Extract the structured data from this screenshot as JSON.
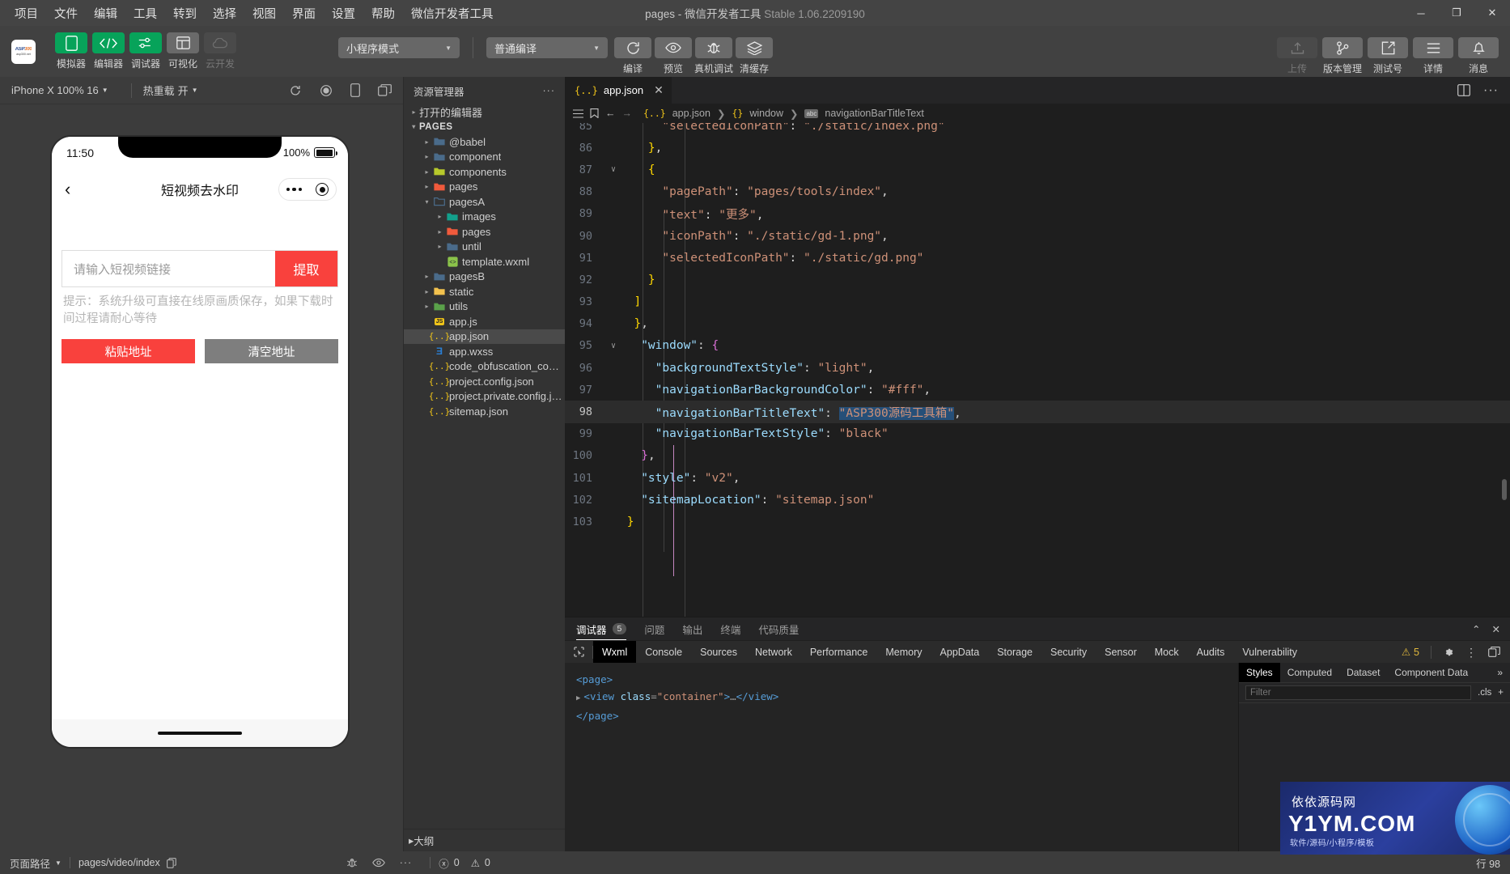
{
  "titlebar": {
    "menus": [
      "项目",
      "文件",
      "编辑",
      "工具",
      "转到",
      "选择",
      "视图",
      "界面",
      "设置",
      "帮助",
      "微信开发者工具"
    ],
    "title_main": "pages - 微信开发者工具 ",
    "title_version": "Stable 1.06.2209190",
    "minimize": "─",
    "maximize": "❐",
    "close": "✕"
  },
  "toolbar": {
    "logo_line1": "ASP300",
    "logo_line2": "asp300.net",
    "left_buttons": [
      {
        "label": "模拟器",
        "icon": "phone-icon",
        "style": "green"
      },
      {
        "label": "编辑器",
        "icon": "code-icon",
        "style": "green"
      },
      {
        "label": "调试器",
        "icon": "sliders-icon",
        "style": "green"
      },
      {
        "label": "可视化",
        "icon": "layout-icon",
        "style": "grey"
      },
      {
        "label": "云开发",
        "icon": "cloud-icon",
        "style": "off"
      }
    ],
    "mode_select": "小程序模式",
    "compile_select": "普通编译",
    "mid_buttons": [
      {
        "label": "编译",
        "icon": "refresh-icon"
      },
      {
        "label": "预览",
        "icon": "eye-icon"
      },
      {
        "label": "真机调试",
        "icon": "bug-icon"
      },
      {
        "label": "清缓存",
        "icon": "layers-icon"
      }
    ],
    "right_buttons": [
      {
        "label": "上传",
        "icon": "upload-icon",
        "disabled": true
      },
      {
        "label": "版本管理",
        "icon": "branch-icon",
        "disabled": false
      },
      {
        "label": "测试号",
        "icon": "external-link-icon",
        "disabled": false
      },
      {
        "label": "详情",
        "icon": "menu-icon",
        "disabled": false
      },
      {
        "label": "消息",
        "icon": "bell-icon",
        "disabled": false
      }
    ]
  },
  "simulator": {
    "device_select": "iPhone X 100% 16",
    "hotreload_label": "热重载",
    "hotreload_value": "开",
    "icons": [
      "refresh-icon",
      "record-icon",
      "rotate-icon",
      "popout-icon"
    ],
    "phone": {
      "status_time": "11:50",
      "battery_percent": "100%",
      "nav_title": "短视频去水印",
      "back_icon": "chevron-left-icon",
      "input_placeholder": "请输入短视频链接",
      "extract_button": "提取",
      "tip_text": "提示：系统升级可直接在线原画质保存，如果下载时间过程请耐心等待",
      "paste_button": "粘贴地址",
      "clear_button": "清空地址"
    }
  },
  "explorer": {
    "header": "资源管理器",
    "more_icon": "ellipsis-icon",
    "open_editors": "打开的编辑器",
    "project_root": "PAGES",
    "outline": "大纲",
    "tree": [
      {
        "name": "@babel",
        "indent": 1,
        "type": "folder",
        "arrow": "▸",
        "color": "#4a6b8a",
        "selected": false
      },
      {
        "name": "component",
        "indent": 1,
        "type": "folder",
        "arrow": "▸",
        "color": "#4a6b8a",
        "selected": false
      },
      {
        "name": "components",
        "indent": 1,
        "type": "folder",
        "arrow": "▸",
        "color": "#b7c92b",
        "selected": false
      },
      {
        "name": "pages",
        "indent": 1,
        "type": "folder",
        "arrow": "▸",
        "color": "#f05a3c",
        "selected": false
      },
      {
        "name": "pagesA",
        "indent": 1,
        "type": "folder-open",
        "arrow": "▾",
        "color": "#4a6b8a",
        "selected": false
      },
      {
        "name": "images",
        "indent": 2,
        "type": "folder",
        "arrow": "▸",
        "color": "#13a08c",
        "selected": false
      },
      {
        "name": "pages",
        "indent": 2,
        "type": "folder",
        "arrow": "▸",
        "color": "#f05a3c",
        "selected": false
      },
      {
        "name": "until",
        "indent": 2,
        "type": "folder",
        "arrow": "▸",
        "color": "#4a6b8a",
        "selected": false
      },
      {
        "name": "template.wxml",
        "indent": 2,
        "type": "wxml",
        "arrow": "",
        "color": "#8bc34a",
        "selected": false
      },
      {
        "name": "pagesB",
        "indent": 1,
        "type": "folder",
        "arrow": "▸",
        "color": "#4a6b8a",
        "selected": false
      },
      {
        "name": "static",
        "indent": 1,
        "type": "folder",
        "arrow": "▸",
        "color": "#f2c14e",
        "selected": false
      },
      {
        "name": "utils",
        "indent": 1,
        "type": "folder",
        "arrow": "▸",
        "color": "#5aa14a",
        "selected": false
      },
      {
        "name": "app.js",
        "indent": 1,
        "type": "js",
        "arrow": "",
        "color": "#f0c419",
        "selected": false
      },
      {
        "name": "app.json",
        "indent": 1,
        "type": "json",
        "arrow": "",
        "color": "#f0c419",
        "selected": true
      },
      {
        "name": "app.wxss",
        "indent": 1,
        "type": "wxss",
        "arrow": "",
        "color": "#2a7fd4",
        "selected": false
      },
      {
        "name": "code_obfuscation_conf...",
        "indent": 1,
        "type": "json",
        "arrow": "",
        "color": "#f0c419",
        "selected": false
      },
      {
        "name": "project.config.json",
        "indent": 1,
        "type": "json",
        "arrow": "",
        "color": "#f0c419",
        "selected": false
      },
      {
        "name": "project.private.config.js...",
        "indent": 1,
        "type": "json",
        "arrow": "",
        "color": "#f0c419",
        "selected": false
      },
      {
        "name": "sitemap.json",
        "indent": 1,
        "type": "json",
        "arrow": "",
        "color": "#f0c419",
        "selected": false
      }
    ]
  },
  "editor": {
    "tab_label": "app.json",
    "tab_icon": "json-icon",
    "close_icon": "✕",
    "breadcrumb": [
      "app.json",
      "window",
      "navigationBarTitleText"
    ],
    "toolbar_icons": [
      "outline-icon",
      "bookmark-icon",
      "back-arrow-icon",
      "forward-arrow-icon"
    ],
    "split_icon": "split-editor-icon",
    "more_icon": "ellipsis-icon",
    "lines": [
      {
        "num": "85",
        "fold": "",
        "hl": false,
        "partial": true,
        "tokens": [
          {
            "t": "      ",
            "c": "p"
          },
          {
            "t": "\"selectedIconPath\"",
            "c": "s"
          },
          {
            "t": ": ",
            "c": "p"
          },
          {
            "t": "\"./static/index.png\"",
            "c": "s"
          }
        ]
      },
      {
        "num": "86",
        "fold": "",
        "hl": false,
        "tokens": [
          {
            "t": "    ",
            "c": "p"
          },
          {
            "t": "}",
            "c": "b1"
          },
          {
            "t": ",",
            "c": "p"
          }
        ]
      },
      {
        "num": "87",
        "fold": "∨",
        "hl": false,
        "tokens": [
          {
            "t": "    ",
            "c": "p"
          },
          {
            "t": "{",
            "c": "b1"
          }
        ]
      },
      {
        "num": "88",
        "fold": "",
        "hl": false,
        "tokens": [
          {
            "t": "      ",
            "c": "p"
          },
          {
            "t": "\"pagePath\"",
            "c": "s"
          },
          {
            "t": ": ",
            "c": "p"
          },
          {
            "t": "\"pages/tools/index\"",
            "c": "s"
          },
          {
            "t": ",",
            "c": "p"
          }
        ]
      },
      {
        "num": "89",
        "fold": "",
        "hl": false,
        "tokens": [
          {
            "t": "      ",
            "c": "p"
          },
          {
            "t": "\"text\"",
            "c": "s"
          },
          {
            "t": ": ",
            "c": "p"
          },
          {
            "t": "\"更多\"",
            "c": "s"
          },
          {
            "t": ",",
            "c": "p"
          }
        ]
      },
      {
        "num": "90",
        "fold": "",
        "hl": false,
        "tokens": [
          {
            "t": "      ",
            "c": "p"
          },
          {
            "t": "\"iconPath\"",
            "c": "s"
          },
          {
            "t": ": ",
            "c": "p"
          },
          {
            "t": "\"./static/gd-1.png\"",
            "c": "s"
          },
          {
            "t": ",",
            "c": "p"
          }
        ]
      },
      {
        "num": "91",
        "fold": "",
        "hl": false,
        "tokens": [
          {
            "t": "      ",
            "c": "p"
          },
          {
            "t": "\"selectedIconPath\"",
            "c": "s"
          },
          {
            "t": ": ",
            "c": "p"
          },
          {
            "t": "\"./static/gd.png\"",
            "c": "s"
          }
        ]
      },
      {
        "num": "92",
        "fold": "",
        "hl": false,
        "tokens": [
          {
            "t": "    ",
            "c": "p"
          },
          {
            "t": "}",
            "c": "b1"
          }
        ]
      },
      {
        "num": "93",
        "fold": "",
        "hl": false,
        "tokens": [
          {
            "t": "  ",
            "c": "p"
          },
          {
            "t": "]",
            "c": "b1"
          }
        ]
      },
      {
        "num": "94",
        "fold": "",
        "hl": false,
        "tokens": [
          {
            "t": "  ",
            "c": "p"
          },
          {
            "t": "}",
            "c": "b1"
          },
          {
            "t": ",",
            "c": "p"
          }
        ]
      },
      {
        "num": "95",
        "fold": "∨",
        "hl": false,
        "tokens": [
          {
            "t": "   ",
            "c": "p"
          },
          {
            "t": "\"window\"",
            "c": "k"
          },
          {
            "t": ": ",
            "c": "p"
          },
          {
            "t": "{",
            "c": "b2"
          }
        ]
      },
      {
        "num": "96",
        "fold": "",
        "hl": false,
        "tokens": [
          {
            "t": "     ",
            "c": "p"
          },
          {
            "t": "\"backgroundTextStyle\"",
            "c": "k"
          },
          {
            "t": ": ",
            "c": "p"
          },
          {
            "t": "\"light\"",
            "c": "s"
          },
          {
            "t": ",",
            "c": "p"
          }
        ]
      },
      {
        "num": "97",
        "fold": "",
        "hl": false,
        "tokens": [
          {
            "t": "     ",
            "c": "p"
          },
          {
            "t": "\"navigationBarBackgroundColor\"",
            "c": "k"
          },
          {
            "t": ": ",
            "c": "p"
          },
          {
            "t": "\"#fff\"",
            "c": "s"
          },
          {
            "t": ",",
            "c": "p"
          }
        ]
      },
      {
        "num": "98",
        "fold": "",
        "hl": true,
        "tokens": [
          {
            "t": "     ",
            "c": "p"
          },
          {
            "t": "\"navigationBarTitleText\"",
            "c": "k"
          },
          {
            "t": ": ",
            "c": "p"
          },
          {
            "t": "\"ASP300源码工具箱\"",
            "c": "s sel"
          },
          {
            "t": ",",
            "c": "p"
          }
        ]
      },
      {
        "num": "99",
        "fold": "",
        "hl": false,
        "tokens": [
          {
            "t": "     ",
            "c": "p"
          },
          {
            "t": "\"navigationBarTextStyle\"",
            "c": "k"
          },
          {
            "t": ": ",
            "c": "p"
          },
          {
            "t": "\"black\"",
            "c": "s"
          }
        ]
      },
      {
        "num": "100",
        "fold": "",
        "hl": false,
        "tokens": [
          {
            "t": "   ",
            "c": "p"
          },
          {
            "t": "}",
            "c": "b2"
          },
          {
            "t": ",",
            "c": "p"
          }
        ]
      },
      {
        "num": "101",
        "fold": "",
        "hl": false,
        "tokens": [
          {
            "t": "   ",
            "c": "p"
          },
          {
            "t": "\"style\"",
            "c": "k"
          },
          {
            "t": ": ",
            "c": "p"
          },
          {
            "t": "\"v2\"",
            "c": "s"
          },
          {
            "t": ",",
            "c": "p"
          }
        ]
      },
      {
        "num": "102",
        "fold": "",
        "hl": false,
        "tokens": [
          {
            "t": "   ",
            "c": "p"
          },
          {
            "t": "\"sitemapLocation\"",
            "c": "k"
          },
          {
            "t": ": ",
            "c": "p"
          },
          {
            "t": "\"sitemap.json\"",
            "c": "s"
          }
        ]
      },
      {
        "num": "103",
        "fold": "",
        "hl": false,
        "tokens": [
          {
            "t": " ",
            "c": "p"
          },
          {
            "t": "}",
            "c": "b1"
          }
        ]
      }
    ]
  },
  "devtools": {
    "panel_tabs": [
      {
        "label": "调试器",
        "badge": "5",
        "active": true
      },
      {
        "label": "问题",
        "badge": "",
        "active": false
      },
      {
        "label": "输出",
        "badge": "",
        "active": false
      },
      {
        "label": "终端",
        "badge": "",
        "active": false
      },
      {
        "label": "代码质量",
        "badge": "",
        "active": false
      }
    ],
    "collapse_icon": "chevron-up-icon",
    "close_icon": "✕",
    "inspector_icon": "cursor-select-icon",
    "tabs": [
      "Wxml",
      "Console",
      "Sources",
      "Network",
      "Performance",
      "Memory",
      "AppData",
      "Storage",
      "Security",
      "Sensor",
      "Mock",
      "Audits",
      "Vulnerability"
    ],
    "active_tab": "Wxml",
    "warning_count": "5",
    "warning_icon": "warning-triangle-icon",
    "gear_icon": "gear-icon",
    "kebab_icon": "kebab-menu-icon",
    "dock_icon": "dock-icon",
    "dom": [
      {
        "indent": 0,
        "arrow": "",
        "html": "page",
        "kind": "open"
      },
      {
        "indent": 1,
        "arrow": "▸",
        "html": "view",
        "kind": "selfcontent",
        "attr": "class",
        "value": "\"container\""
      },
      {
        "indent": 0,
        "arrow": "",
        "html": "page",
        "kind": "close"
      }
    ],
    "side_tabs": [
      "Styles",
      "Computed",
      "Dataset",
      "Component Data"
    ],
    "side_active": "Styles",
    "side_more": "»",
    "filter_placeholder": "Filter",
    "cls_label": ".cls",
    "add_icon": "+"
  },
  "watermark": {
    "line1": "依依源码网",
    "line2": "Y1YM.COM",
    "line3": "软件/源码/小程序/模板"
  },
  "statusbar": {
    "page_path_label": "页面路径",
    "page_path_value": "pages/video/index",
    "copy_icon": "copy-icon",
    "icons": [
      "bug-icon",
      "eye-icon",
      "ellipsis-icon"
    ],
    "error_icon": "error-circle-icon",
    "error_count": "0",
    "warn_icon": "warning-triangle-icon",
    "warn_count": "0",
    "line_info": "行 98"
  }
}
